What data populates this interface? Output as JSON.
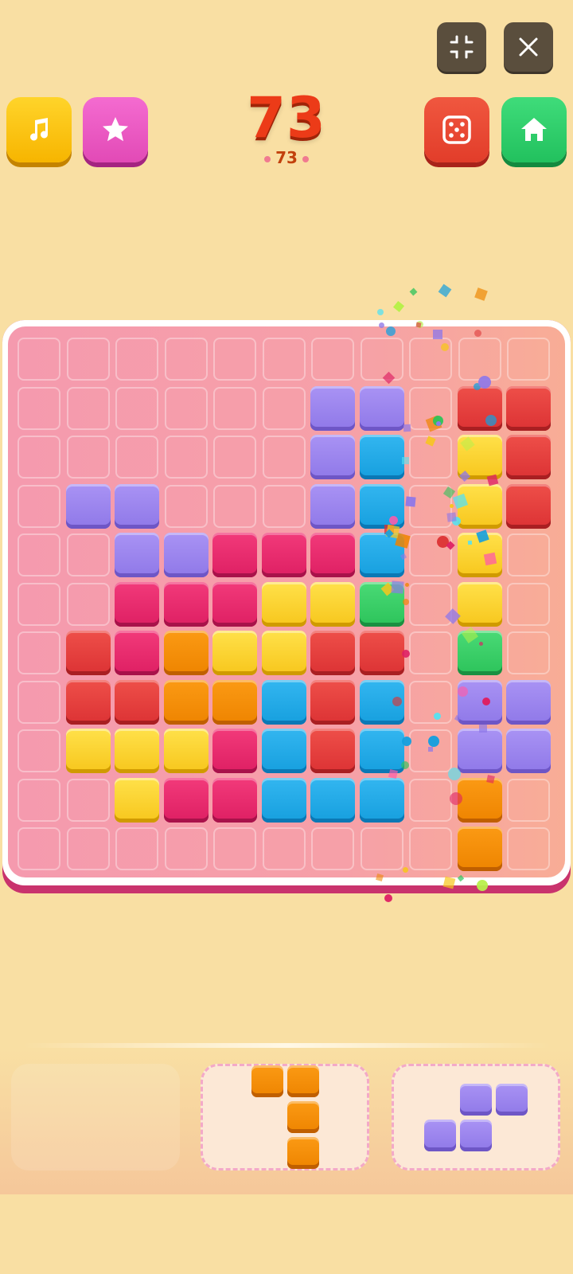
{
  "score": {
    "current": "73",
    "best": "73"
  },
  "buttons": {
    "shrink": "shrink-icon",
    "close": "close-icon",
    "music": "music-icon",
    "favorite": "star-icon",
    "dice": "dice-icon",
    "home": "home-icon"
  },
  "colors": {
    "purple": "#8f78e8",
    "red": "#dc3234",
    "yellow": "#f7c61c",
    "blue": "#169fde",
    "magenta": "#de1f63",
    "orange": "#ee8400",
    "green": "#2cc35a"
  },
  "board": {
    "columns": 11,
    "rows": 11,
    "filled": [
      {
        "r": 1,
        "c": 6,
        "color": "purple"
      },
      {
        "r": 1,
        "c": 7,
        "color": "purple"
      },
      {
        "r": 1,
        "c": 9,
        "color": "red"
      },
      {
        "r": 1,
        "c": 10,
        "color": "red"
      },
      {
        "r": 2,
        "c": 6,
        "color": "purple"
      },
      {
        "r": 2,
        "c": 7,
        "color": "blue"
      },
      {
        "r": 2,
        "c": 9,
        "color": "yellow"
      },
      {
        "r": 2,
        "c": 10,
        "color": "red"
      },
      {
        "r": 3,
        "c": 1,
        "color": "purple"
      },
      {
        "r": 3,
        "c": 2,
        "color": "purple"
      },
      {
        "r": 3,
        "c": 6,
        "color": "purple"
      },
      {
        "r": 3,
        "c": 7,
        "color": "blue"
      },
      {
        "r": 3,
        "c": 9,
        "color": "yellow"
      },
      {
        "r": 3,
        "c": 10,
        "color": "red"
      },
      {
        "r": 4,
        "c": 2,
        "color": "purple"
      },
      {
        "r": 4,
        "c": 3,
        "color": "purple"
      },
      {
        "r": 4,
        "c": 4,
        "color": "magenta"
      },
      {
        "r": 4,
        "c": 5,
        "color": "magenta"
      },
      {
        "r": 4,
        "c": 6,
        "color": "magenta"
      },
      {
        "r": 4,
        "c": 7,
        "color": "blue"
      },
      {
        "r": 4,
        "c": 9,
        "color": "yellow"
      },
      {
        "r": 5,
        "c": 2,
        "color": "magenta"
      },
      {
        "r": 5,
        "c": 3,
        "color": "magenta"
      },
      {
        "r": 5,
        "c": 4,
        "color": "magenta"
      },
      {
        "r": 5,
        "c": 5,
        "color": "yellow"
      },
      {
        "r": 5,
        "c": 6,
        "color": "yellow"
      },
      {
        "r": 5,
        "c": 7,
        "color": "green"
      },
      {
        "r": 5,
        "c": 9,
        "color": "yellow"
      },
      {
        "r": 6,
        "c": 1,
        "color": "red"
      },
      {
        "r": 6,
        "c": 2,
        "color": "magenta"
      },
      {
        "r": 6,
        "c": 3,
        "color": "orange"
      },
      {
        "r": 6,
        "c": 4,
        "color": "yellow"
      },
      {
        "r": 6,
        "c": 5,
        "color": "yellow"
      },
      {
        "r": 6,
        "c": 6,
        "color": "red"
      },
      {
        "r": 6,
        "c": 7,
        "color": "red"
      },
      {
        "r": 6,
        "c": 9,
        "color": "green"
      },
      {
        "r": 7,
        "c": 1,
        "color": "red"
      },
      {
        "r": 7,
        "c": 2,
        "color": "red"
      },
      {
        "r": 7,
        "c": 3,
        "color": "orange"
      },
      {
        "r": 7,
        "c": 4,
        "color": "orange"
      },
      {
        "r": 7,
        "c": 5,
        "color": "blue"
      },
      {
        "r": 7,
        "c": 6,
        "color": "red"
      },
      {
        "r": 7,
        "c": 7,
        "color": "blue"
      },
      {
        "r": 7,
        "c": 9,
        "color": "purple"
      },
      {
        "r": 7,
        "c": 10,
        "color": "purple"
      },
      {
        "r": 8,
        "c": 1,
        "color": "yellow"
      },
      {
        "r": 8,
        "c": 2,
        "color": "yellow"
      },
      {
        "r": 8,
        "c": 3,
        "color": "yellow"
      },
      {
        "r": 8,
        "c": 4,
        "color": "magenta"
      },
      {
        "r": 8,
        "c": 5,
        "color": "blue"
      },
      {
        "r": 8,
        "c": 6,
        "color": "red"
      },
      {
        "r": 8,
        "c": 7,
        "color": "blue"
      },
      {
        "r": 8,
        "c": 9,
        "color": "purple"
      },
      {
        "r": 8,
        "c": 10,
        "color": "purple"
      },
      {
        "r": 9,
        "c": 2,
        "color": "yellow"
      },
      {
        "r": 9,
        "c": 3,
        "color": "magenta"
      },
      {
        "r": 9,
        "c": 4,
        "color": "magenta"
      },
      {
        "r": 9,
        "c": 5,
        "color": "blue"
      },
      {
        "r": 9,
        "c": 6,
        "color": "blue"
      },
      {
        "r": 9,
        "c": 7,
        "color": "blue"
      },
      {
        "r": 9,
        "c": 9,
        "color": "orange"
      },
      {
        "r": 10,
        "c": 9,
        "color": "orange"
      }
    ]
  },
  "tray": {
    "slots": [
      {
        "empty": true,
        "cells": []
      },
      {
        "empty": false,
        "color": "orange",
        "cells": [
          [
            0,
            0
          ],
          [
            0,
            1
          ],
          [
            1,
            1
          ],
          [
            2,
            1
          ]
        ]
      },
      {
        "empty": false,
        "color": "purple",
        "cells": [
          [
            0,
            1
          ],
          [
            0,
            2
          ],
          [
            1,
            0
          ],
          [
            1,
            1
          ]
        ]
      }
    ]
  }
}
